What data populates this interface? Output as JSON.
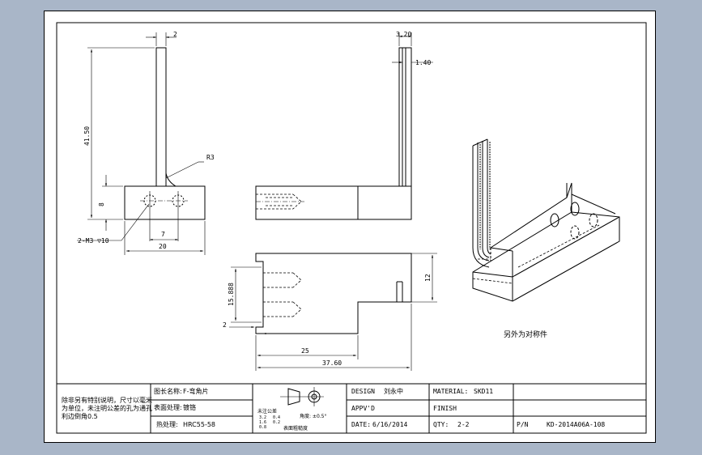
{
  "colors": {
    "background": "#a9b6c8",
    "sheet": "#ffffff",
    "line": "#000000"
  },
  "front_view": {
    "dim_thickness": "2",
    "dim_height": "41.50",
    "radius_label": "R3",
    "dim_base_height": "8",
    "hole_callout": "2-M3 ▽10",
    "dim_hole_spacing": "7",
    "dim_width": "20"
  },
  "side_view": {
    "dim_outer_width": "3.20",
    "dim_slot": "1.40"
  },
  "top_view": {
    "dim_depth": "12",
    "dim_hole_pitch": "15.888",
    "dim_offset": "2",
    "dim_length_inner": "25",
    "dim_length_total": "37.60"
  },
  "iso_view": {
    "note": "另外为对称件"
  },
  "title_block": {
    "tech_note": [
      "除非另有特别说明，尺寸以毫米",
      "为单位，未注明公差的孔为通孔",
      "利边倒角0.5"
    ],
    "part_name_label": "图长名称:",
    "part_name": "F-弯角片",
    "surface_label": "表面处理:",
    "surface": "镀铬",
    "heat_label": "热处理:",
    "heat": "HRC55-58",
    "roughness_label": "表面粗糙度",
    "roughness_values": [
      "3.2",
      "1.6",
      "0.8",
      "0.4",
      "0.2"
    ],
    "dim_label": "未注公差",
    "angle_label": "角度: ±0.5°",
    "design_label": "DESIGN",
    "design_value": "刘永中",
    "approved_label": "APPV'D",
    "approved_value": "",
    "date_label": "DATE:",
    "date_value": "6/16/2014",
    "material_label": "MATERIAL:",
    "material_value": "SKD11",
    "finish_label": "FINISH",
    "finish_value": "",
    "qty_label": "QTY:",
    "qty_value": "2-2",
    "pn_label": "P/N",
    "pn_value": "KD-2014A06A-108"
  }
}
